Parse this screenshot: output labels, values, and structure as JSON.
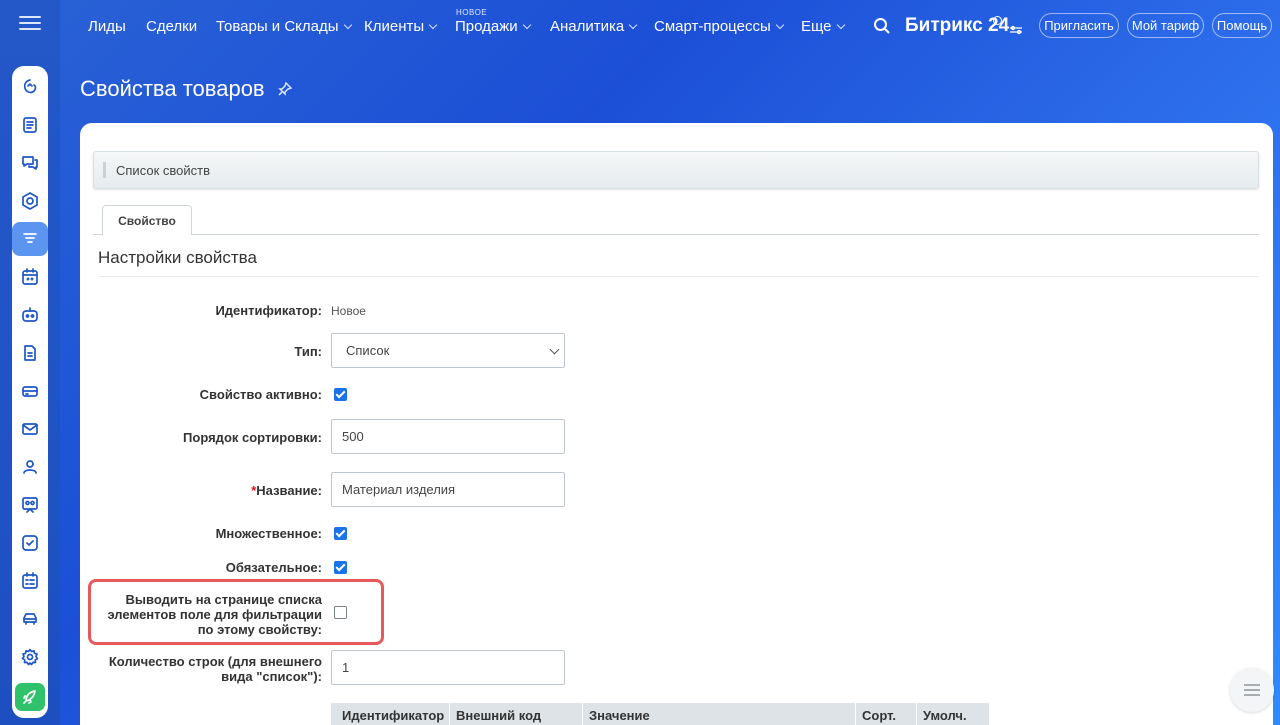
{
  "nav": {
    "items": [
      {
        "label": "Лиды"
      },
      {
        "label": "Сделки"
      },
      {
        "label": "Товары и Склады"
      },
      {
        "label": "Клиенты"
      },
      {
        "label": "Продажи"
      },
      {
        "label": "Аналитика"
      },
      {
        "label": "Смарт-процессы"
      },
      {
        "label": "Еще"
      }
    ],
    "new_badge": "НОВОЕ",
    "brand": "Битрикс 24",
    "invite": "Пригласить",
    "tariff": "Мой тариф",
    "help": "Помощь"
  },
  "rail": {
    "icons": [
      "bitrix-icon",
      "feed-icon",
      "chat-icon",
      "hexagon-icon",
      "crm-icon",
      "calendar-icon",
      "robot-icon",
      "document-icon",
      "storage-icon",
      "mail-icon",
      "contacts-icon",
      "meeting-icon",
      "tasks-icon",
      "schedule-icon",
      "car-icon",
      "settings-icon",
      "rocket-icon"
    ]
  },
  "page": {
    "title": "Свойства товаров"
  },
  "toolbar": {
    "list_label": "Список свойств"
  },
  "tabs": {
    "property": "Свойство"
  },
  "form": {
    "section_title": "Настройки свойства",
    "id_label": "Идентификатор:",
    "id_value": "Новое",
    "type_label": "Тип:",
    "type_value": "Список",
    "active_label": "Свойство активно:",
    "active_checked": true,
    "sort_label": "Порядок сортировки:",
    "sort_value": "500",
    "name_required": "*",
    "name_label": "Название:",
    "name_value": "Материал изделия",
    "multiple_label": "Множественное:",
    "multiple_checked": true,
    "required_label": "Обязательное:",
    "required_checked": true,
    "filter_label_line1": "Выводить на странице списка",
    "filter_label_line2": "элементов поле для фильтрации",
    "filter_label_line3": "по этому свойству:",
    "filter_checked": false,
    "rows_label_line1": "Количество строк (для внешнего",
    "rows_label_line2": "вида \"список\"):",
    "rows_value": "1"
  },
  "values_table": {
    "headers": [
      "Идентификатор",
      "Внешний код",
      "Значение",
      "Сорт.",
      "Умолч."
    ]
  },
  "colors": {
    "accent": "#1a73e8",
    "highlight": "#e8595c"
  }
}
